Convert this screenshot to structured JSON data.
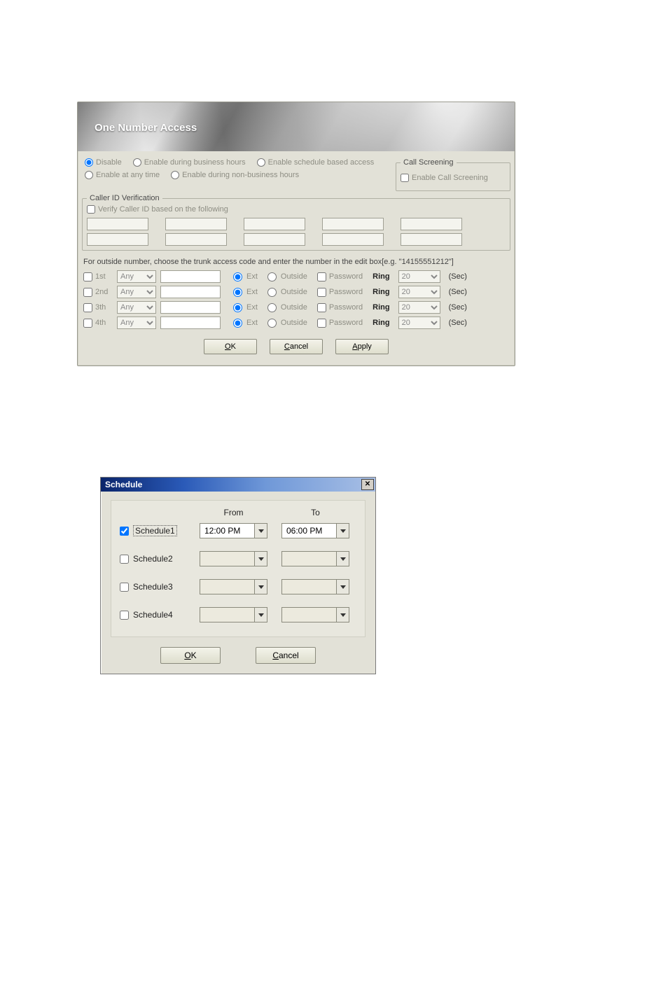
{
  "ona": {
    "title": "One Number Access",
    "options": {
      "disable": "Disable",
      "business": "Enable during business hours",
      "schedule": "Enable schedule based access",
      "anytime": "Enable at any time",
      "nonbusiness": "Enable during non-business hours"
    },
    "selected_option": "disable",
    "call_screening": {
      "legend": "Call Screening",
      "label": "Enable Call Screening",
      "checked": false
    },
    "caller_id": {
      "legend": "Caller ID Verification",
      "verify_label": "Verify Caller ID based on the following",
      "verify_checked": false,
      "fields": [
        "",
        "",
        "",
        "",
        "",
        "",
        "",
        "",
        "",
        ""
      ]
    },
    "forward": {
      "hint": "For outside number, choose the trunk access code and enter the number in the edit box[e.g. \"14155551212\"]",
      "rows": [
        {
          "ord": "1st",
          "checked": false,
          "trunk": "Any",
          "number": "",
          "type": "Ext",
          "ext_label": "Ext",
          "out_label": "Outside",
          "pw_label": "Password",
          "pw_checked": false,
          "ring_label": "Ring",
          "ring_val": "20",
          "sec": "(Sec)"
        },
        {
          "ord": "2nd",
          "checked": false,
          "trunk": "Any",
          "number": "",
          "type": "Ext",
          "ext_label": "Ext",
          "out_label": "Outside",
          "pw_label": "Password",
          "pw_checked": false,
          "ring_label": "Ring",
          "ring_val": "20",
          "sec": "(Sec)"
        },
        {
          "ord": "3th",
          "checked": false,
          "trunk": "Any",
          "number": "",
          "type": "Ext",
          "ext_label": "Ext",
          "out_label": "Outside",
          "pw_label": "Password",
          "pw_checked": false,
          "ring_label": "Ring",
          "ring_val": "20",
          "sec": "(Sec)"
        },
        {
          "ord": "4th",
          "checked": false,
          "trunk": "Any",
          "number": "",
          "type": "Ext",
          "ext_label": "Ext",
          "out_label": "Outside",
          "pw_label": "Password",
          "pw_checked": false,
          "ring_label": "Ring",
          "ring_val": "20",
          "sec": "(Sec)"
        }
      ]
    },
    "buttons": {
      "ok_u": "O",
      "ok_rest": "K",
      "cancel_u": "C",
      "cancel_rest": "ancel",
      "apply_u": "A",
      "apply_rest": "pply"
    }
  },
  "schedule": {
    "title": "Schedule",
    "from": "From",
    "to": "To",
    "rows": [
      {
        "label": "Schedule1",
        "checked": true,
        "from": "12:00 PM",
        "to": "06:00 PM",
        "enabled": true
      },
      {
        "label": "Schedule2",
        "checked": false,
        "from": "",
        "to": "",
        "enabled": false
      },
      {
        "label": "Schedule3",
        "checked": false,
        "from": "",
        "to": "",
        "enabled": false
      },
      {
        "label": "Schedule4",
        "checked": false,
        "from": "",
        "to": "",
        "enabled": false
      }
    ],
    "buttons": {
      "ok_u": "O",
      "ok_rest": "K",
      "cancel_u": "C",
      "cancel_rest": "ancel"
    }
  }
}
